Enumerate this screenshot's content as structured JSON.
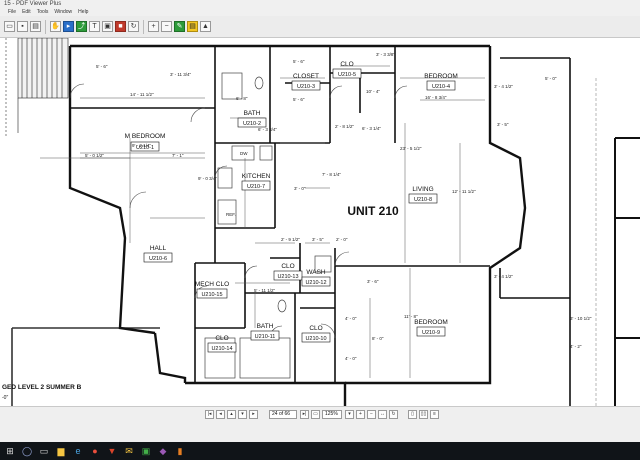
{
  "window": {
    "title": "15 - PDF Viewer Plus"
  },
  "menu": [
    "File",
    "Edit",
    "Tools",
    "Window",
    "Help"
  ],
  "plan": {
    "unit_title": "UNIT 210",
    "rooms": [
      {
        "name": "M BEDROOM",
        "tag": "U210-1"
      },
      {
        "name": "BATH",
        "tag": "U210-2"
      },
      {
        "name": "CLOSET",
        "tag": "U210-3"
      },
      {
        "name": "CLO",
        "tag": "U210-5"
      },
      {
        "name": "BEDROOM",
        "tag": "U210-4"
      },
      {
        "name": "KITCHEN",
        "tag": "U210-7"
      },
      {
        "name": "LIVING",
        "tag": "U210-8"
      },
      {
        "name": "HALL",
        "tag": "U210-6"
      },
      {
        "name": "MECH CLO",
        "tag": "U210-15"
      },
      {
        "name": "CLO",
        "tag": "U210-13"
      },
      {
        "name": "WASH",
        "tag": "U210-12"
      },
      {
        "name": "CLO",
        "tag": "U210-14"
      },
      {
        "name": "BATH",
        "tag": "U210-11"
      },
      {
        "name": "CLO",
        "tag": "U210-10"
      },
      {
        "name": "BEDROOM",
        "tag": "U210-9"
      }
    ],
    "dims": [
      "5' - 6\"",
      "14' - 11 1/2\"",
      "3' - 11 3/4\"",
      "6' - 8\"",
      "5' - 6\"",
      "6' - 3 3/4\"",
      "5' - 6\"",
      "10' - 4\"",
      "16' - 8 3/4\"",
      "3' - 4 1/2\"",
      "3' - 3 3/8\"",
      "6' - 3 1/4\"",
      "2' - 8 1/2\"",
      "3' - 5\"",
      "23' - 5 1/2\"",
      "5' - 0 1/2\"",
      "7' - 1\"",
      "9' - 2 1/4\"",
      "9' - 0 3/4\"",
      "3' - 0\"",
      "7' - 8 1/4\"",
      "12' - 11 1/2\"",
      "2' - 9 1/2\"",
      "3' - 5\"",
      "2' - 0\"",
      "3' - 4 1/2\"",
      "5' - 11 1/2\"",
      "11' - 8\"",
      "8' - 0\"",
      "4' - 0\"",
      "4' - 2\"",
      "3' - 10 1/2\"",
      "DW",
      "REF.",
      "3' - 6\"",
      "4' - 0\"",
      "5' - 0\""
    ],
    "sheet_label": "GED LEVEL 2  SUMMER B",
    "sheet_scale": "-0\""
  },
  "nav": {
    "page_value": "24 of 66",
    "zoom_value": "125%"
  },
  "taskbar": {
    "time": "",
    "date": ""
  }
}
